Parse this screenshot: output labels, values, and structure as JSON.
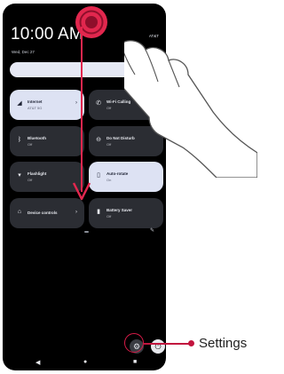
{
  "status": {
    "time": "10:00 AM",
    "date": "Wed, Dec 27",
    "carrier": "AT&T",
    "battery": "100%"
  },
  "quick_settings": {
    "tiles": [
      {
        "name": "tile-internet",
        "title": "Internet",
        "subtitle": "AT&T 5G",
        "icon": "wifi-icon",
        "on": true
      },
      {
        "name": "tile-wifi-calling",
        "title": "Wi-Fi Calling",
        "subtitle": "Off",
        "icon": "phone-wifi-icon",
        "on": false
      },
      {
        "name": "tile-bluetooth",
        "title": "Bluetooth",
        "subtitle": "Off",
        "icon": "bluetooth-icon",
        "on": false
      },
      {
        "name": "tile-do-not-disturb",
        "title": "Do Not Disturb",
        "subtitle": "Off",
        "icon": "do-not-disturb-icon",
        "on": false
      },
      {
        "name": "tile-flashlight",
        "title": "Flashlight",
        "subtitle": "Off",
        "icon": "flashlight-icon",
        "on": false
      },
      {
        "name": "tile-auto-rotate",
        "title": "Auto-rotate",
        "subtitle": "On",
        "icon": "auto-rotate-icon",
        "on": true
      },
      {
        "name": "tile-device-controls",
        "title": "Device controls",
        "subtitle": "",
        "icon": "home-icon",
        "on": false
      },
      {
        "name": "tile-battery-saver",
        "title": "Battery Saver",
        "subtitle": "Off",
        "icon": "battery-icon",
        "on": false
      }
    ]
  },
  "callout": {
    "label": "Settings"
  },
  "colors": {
    "accent": "#d81b48",
    "tile_on": "#dde2f3",
    "tile_off": "#2b2d33"
  }
}
